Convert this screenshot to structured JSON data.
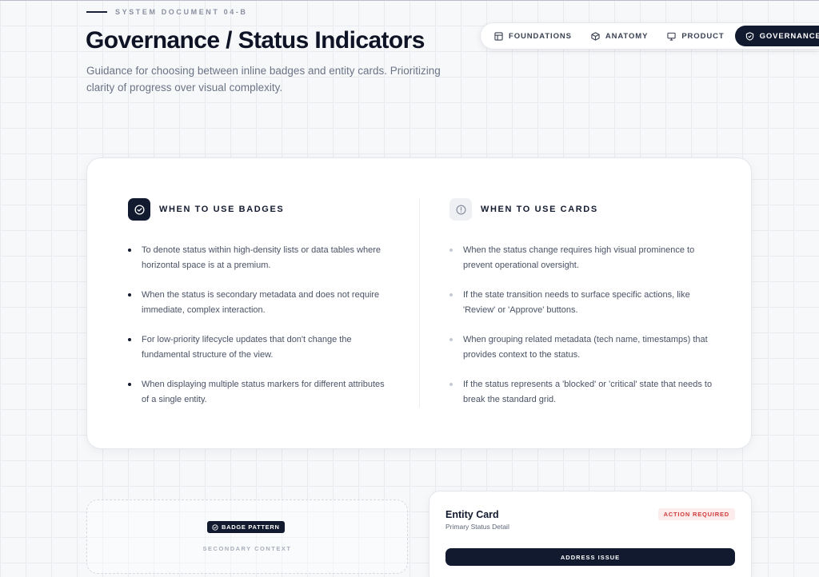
{
  "header": {
    "eyebrow": "SYSTEM DOCUMENT 04-B",
    "title": "Governance / Status Indicators",
    "subtitle": "Guidance for choosing between inline badges and entity cards. Prioritizing clarity of progress over visual complexity."
  },
  "nav": {
    "tabs": [
      {
        "label": "FOUNDATIONS",
        "icon": "layout-icon",
        "active": false
      },
      {
        "label": "ANATOMY",
        "icon": "cube-icon",
        "active": false
      },
      {
        "label": "PRODUCT",
        "icon": "monitor-icon",
        "active": false
      },
      {
        "label": "GOVERNANCE",
        "icon": "shield-check-icon",
        "active": true
      }
    ]
  },
  "guidance": {
    "badges": {
      "heading": "WHEN TO USE BADGES",
      "icon": "check-circle-icon",
      "items": [
        "To denote status within high-density lists or data tables where horizontal space is at a premium.",
        "When the status is secondary metadata and does not require immediate, complex interaction.",
        "For low-priority lifecycle updates that don't change the fundamental structure of the view.",
        "When displaying multiple status markers for different attributes of a single entity."
      ]
    },
    "cards": {
      "heading": "WHEN TO USE CARDS",
      "icon": "alert-circle-icon",
      "items": [
        "When the status change requires high visual prominence to prevent operational oversight.",
        "If the state transition needs to surface specific actions, like 'Review' or 'Approve' buttons.",
        "When grouping related metadata (tech name, timestamps) that provides context to the status.",
        "If the status represents a 'blocked' or 'critical' state that needs to break the standard grid."
      ]
    }
  },
  "examples": {
    "badge_pattern": {
      "label": "BADGE PATTERN",
      "context": "SECONDARY CONTEXT"
    },
    "entity_card": {
      "title": "Entity Card",
      "subtitle": "Primary Status Detail",
      "status": "ACTION REQUIRED",
      "action": "ADDRESS ISSUE"
    }
  },
  "colors": {
    "primary": "#121a2f",
    "danger": "#d23a3a",
    "danger_bg": "#fdecec"
  }
}
